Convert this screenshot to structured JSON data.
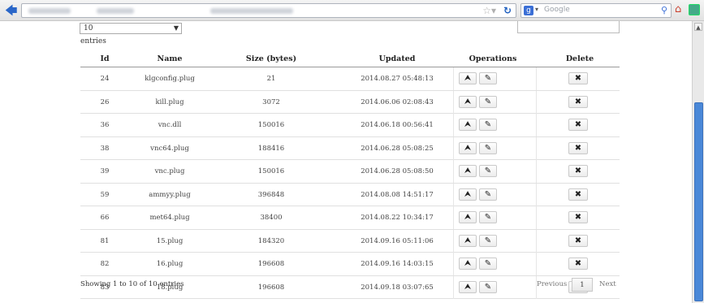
{
  "browser": {
    "search_placeholder": "Google"
  },
  "controls": {
    "length_value": "10",
    "entries_label": "entries"
  },
  "table": {
    "headers": [
      "Id",
      "Name",
      "Size (bytes)",
      "Updated",
      "Operations",
      "Delete"
    ],
    "rows": [
      {
        "id": "24",
        "name": "klgconfig.plug",
        "size": "21",
        "updated": "2014.08.27 05:48:13"
      },
      {
        "id": "26",
        "name": "kill.plug",
        "size": "3072",
        "updated": "2014.06.06 02:08:43"
      },
      {
        "id": "36",
        "name": "vnc.dll",
        "size": "150016",
        "updated": "2014.06.18 00:56:41"
      },
      {
        "id": "38",
        "name": "vnc64.plug",
        "size": "188416",
        "updated": "2014.06.28 05:08:25"
      },
      {
        "id": "39",
        "name": "vnc.plug",
        "size": "150016",
        "updated": "2014.06.28 05:08:50"
      },
      {
        "id": "59",
        "name": "ammyy.plug",
        "size": "396848",
        "updated": "2014.08.08 14:51:17"
      },
      {
        "id": "66",
        "name": "met64.plug",
        "size": "38400",
        "updated": "2014.08.22 10:34:17"
      },
      {
        "id": "81",
        "name": "15.plug",
        "size": "184320",
        "updated": "2014.09.16 05:11:06"
      },
      {
        "id": "82",
        "name": "16.plug",
        "size": "196608",
        "updated": "2014.09.16 14:03:15"
      },
      {
        "id": "83",
        "name": "18.plug",
        "size": "196608",
        "updated": "2014.09.18 03:07:65"
      }
    ],
    "icons": {
      "upload": "upload-icon",
      "edit": "edit-icon",
      "delete": "close-icon"
    }
  },
  "footer": {
    "showing": "Showing 1 to 10 of 10 entries",
    "previous": "Previous",
    "page": "1",
    "next": "Next"
  }
}
